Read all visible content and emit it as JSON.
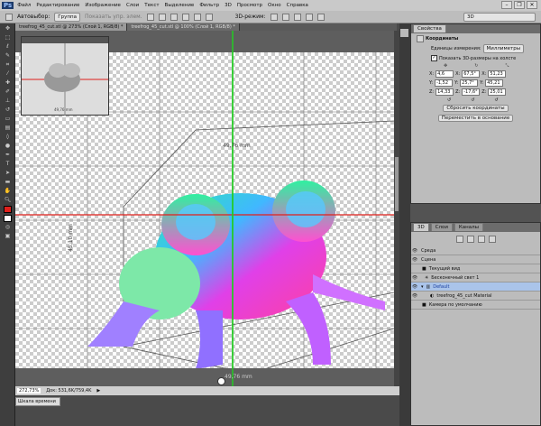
{
  "app": {
    "logo": "Ps"
  },
  "menu": [
    "Файл",
    "Редактирование",
    "Изображение",
    "Слои",
    "Текст",
    "Выделение",
    "Фильтр",
    "3D",
    "Просмотр",
    "Окно",
    "Справка"
  ],
  "options": {
    "autoselect": "Автовыбор:",
    "group": "Группа",
    "show_controls": "Показать упр. элем.",
    "mode3d": "3D-режим:",
    "workspace": "3D"
  },
  "tabs": [
    "treefrog_45_cut.stl @ 273% (Слой 1, RGB/8) *",
    "treefrog_45_cut.stl @ 100% (Слой 1, RGB/8) *"
  ],
  "canvas": {
    "dim_top": "49,76 mm",
    "dim_side": "45,10 mm",
    "dim_bottom": "49,76 mm",
    "thumb_dim": "49,76 mm"
  },
  "status": {
    "zoom": "272,73%",
    "doc": "Док: 531,6K/759,4K",
    "timeline": "Шкала времени"
  },
  "properties": {
    "tab": "Свойства",
    "title": "Координаты",
    "units_label": "Единицы измерения:",
    "units": "Миллиметры",
    "show3d": "Показать 3D-размеры на холсте",
    "rows": [
      {
        "a": "X:",
        "v1": "4,6",
        "b": "X:",
        "v2": "67,5°",
        "c": "X:",
        "v3": "51,23"
      },
      {
        "a": "Y:",
        "v1": "-1,52",
        "b": "Y:",
        "v2": "25,7°",
        "c": "Y:",
        "v3": "45,21"
      },
      {
        "a": "Z:",
        "v1": "14,33",
        "b": "Z:",
        "v2": "-17,6°",
        "c": "Z:",
        "v3": "25,01"
      }
    ],
    "reset": "Сбросить координаты",
    "move": "Переместить в основание"
  },
  "panel3d": {
    "tabs": [
      "3D",
      "Слои",
      "Каналы"
    ],
    "items": [
      "Среда",
      "Сцена",
      "Текущий вид",
      "Бесконечный свет 1",
      "Default",
      "treefrog_45_cut Material",
      "Камера по умолчанию"
    ]
  },
  "colors": {
    "accent": "#aac4ea",
    "guide_red": "#e0201c",
    "guide_green": "#22cc22"
  }
}
